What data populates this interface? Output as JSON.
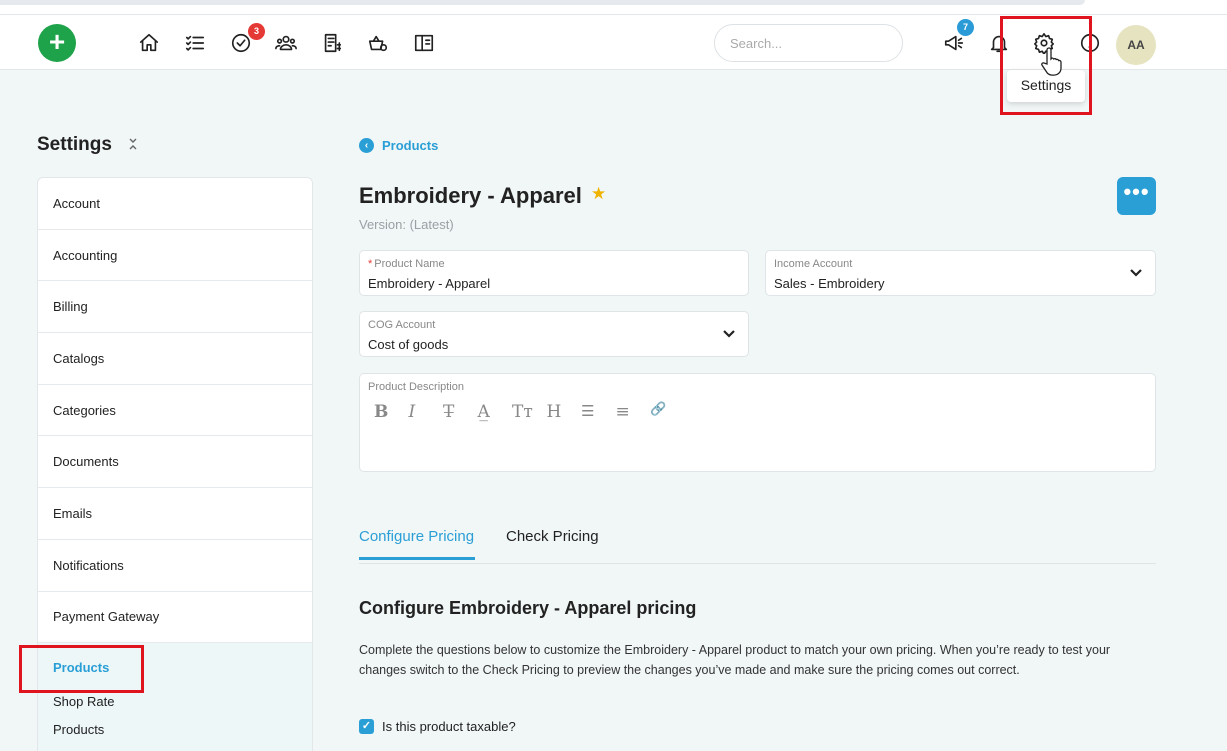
{
  "topbar": {
    "add_label": "+",
    "search_placeholder": "Search...",
    "tasks_badge": "3",
    "announcements_badge": "7",
    "avatar_initials": "AA",
    "settings_tooltip": "Settings"
  },
  "sidebar": {
    "title": "Settings",
    "collapse_glyph": "⌃⌄",
    "items": [
      {
        "label": "Account"
      },
      {
        "label": "Accounting"
      },
      {
        "label": "Billing"
      },
      {
        "label": "Catalogs"
      },
      {
        "label": "Categories"
      },
      {
        "label": "Documents"
      },
      {
        "label": "Emails"
      },
      {
        "label": "Notifications"
      },
      {
        "label": "Payment Gateway"
      }
    ],
    "active": {
      "label": "Products",
      "sub_label_1": "Shop Rate",
      "sub_label_2": "Products"
    }
  },
  "main": {
    "breadcrumb": "Products",
    "title": "Embroidery - Apparel",
    "version": "Version: (Latest)",
    "more_glyph": "•••",
    "fields": {
      "product_name": {
        "label": "Product Name",
        "value": "Embroidery - Apparel"
      },
      "income_account": {
        "label": "Income Account",
        "value": "Sales - Embroidery"
      },
      "cog_account": {
        "label": "COG Account",
        "value": "Cost of goods"
      },
      "description": {
        "label": "Product Description"
      }
    },
    "rte_tools": [
      "B",
      "I",
      "T̶",
      "A̲",
      "Tт",
      "H",
      "☰",
      "≡",
      "🔗"
    ],
    "tabs": {
      "configure": "Configure Pricing",
      "check": "Check Pricing"
    },
    "section_title": "Configure Embroidery - Apparel pricing",
    "section_desc": "Complete the questions below to customize the Embroidery - Apparel product to match your own pricing. When you’re ready to test your changes switch to the Check Pricing to preview the changes you’ve made and make sure the pricing comes out correct.",
    "taxable_label": "Is this product taxable?"
  },
  "colors": {
    "accent": "#2a9fd6",
    "add_button": "#1ea34a",
    "highlight": "#e0141e",
    "star": "#f0b400"
  }
}
